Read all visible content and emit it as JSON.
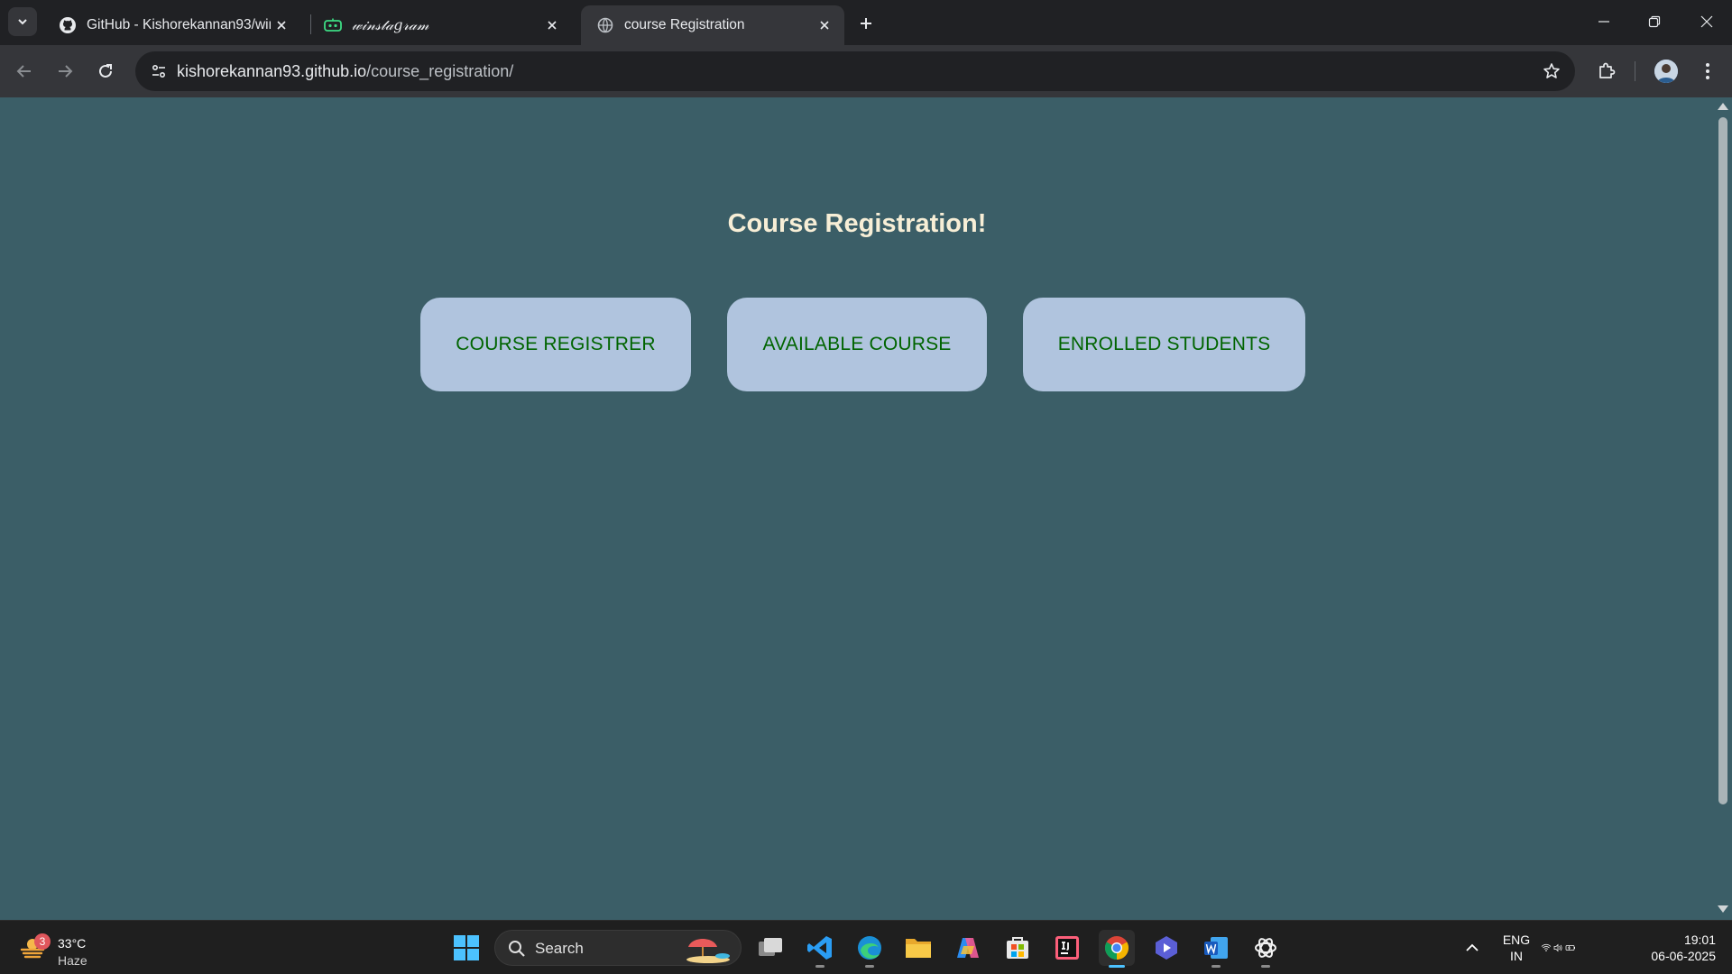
{
  "browser": {
    "tabs": [
      {
        "title": "GitHub - Kishorekannan93/wins",
        "icon": "github-icon",
        "active": false
      },
      {
        "title": "𝓌𝒾𝓃𝓈𝓉𝒶𝑔𝓇𝒶𝓂",
        "icon": "ai-icon",
        "active": false
      },
      {
        "title": "course Registration",
        "icon": "globe-icon",
        "active": true
      }
    ],
    "url_host": "kishorekannan93.github.io",
    "url_path": "/course_registration/"
  },
  "page": {
    "heading": "Course Registration!",
    "buttons": [
      {
        "label": "COURSE REGISTRER"
      },
      {
        "label": "AVAILABLE COURSE"
      },
      {
        "label": "ENROLLED STUDENTS"
      }
    ],
    "background_color": "#3b5e67",
    "button_color": "#b0c4de",
    "button_text_color": "#006400",
    "heading_color": "#f7eed6"
  },
  "taskbar": {
    "weather": {
      "badge": "3",
      "temp": "33°C",
      "condition": "Haze"
    },
    "search_label": "Search",
    "language": {
      "line1": "ENG",
      "line2": "IN"
    },
    "clock": {
      "time": "19:01",
      "date": "06-06-2025"
    }
  }
}
